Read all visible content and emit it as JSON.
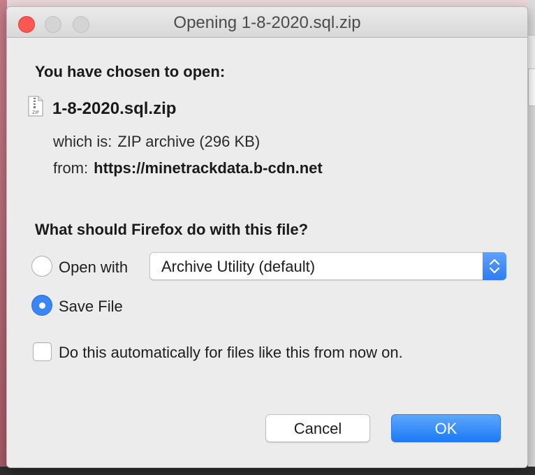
{
  "window": {
    "title": "Opening 1-8-2020.sql.zip"
  },
  "file": {
    "heading": "You have chosen to open:",
    "icon_text": "ZIP",
    "name": "1-8-2020.sql.zip",
    "which_label": "which is:",
    "which_value": "ZIP archive (296 KB)",
    "from_label": "from:",
    "from_value": "https://minetrackdata.b-cdn.net"
  },
  "action": {
    "heading": "What should Firefox do with this file?",
    "open_with_label": "Open with",
    "open_with_app": "Archive Utility (default)",
    "save_file_label": "Save File",
    "selected": "Save File",
    "auto_label": "Do this automatically for files like this from now on.",
    "auto_checked": false
  },
  "buttons": {
    "cancel": "Cancel",
    "ok": "OK"
  },
  "colors": {
    "accent": "#3b86f7",
    "close": "#fc5753"
  }
}
